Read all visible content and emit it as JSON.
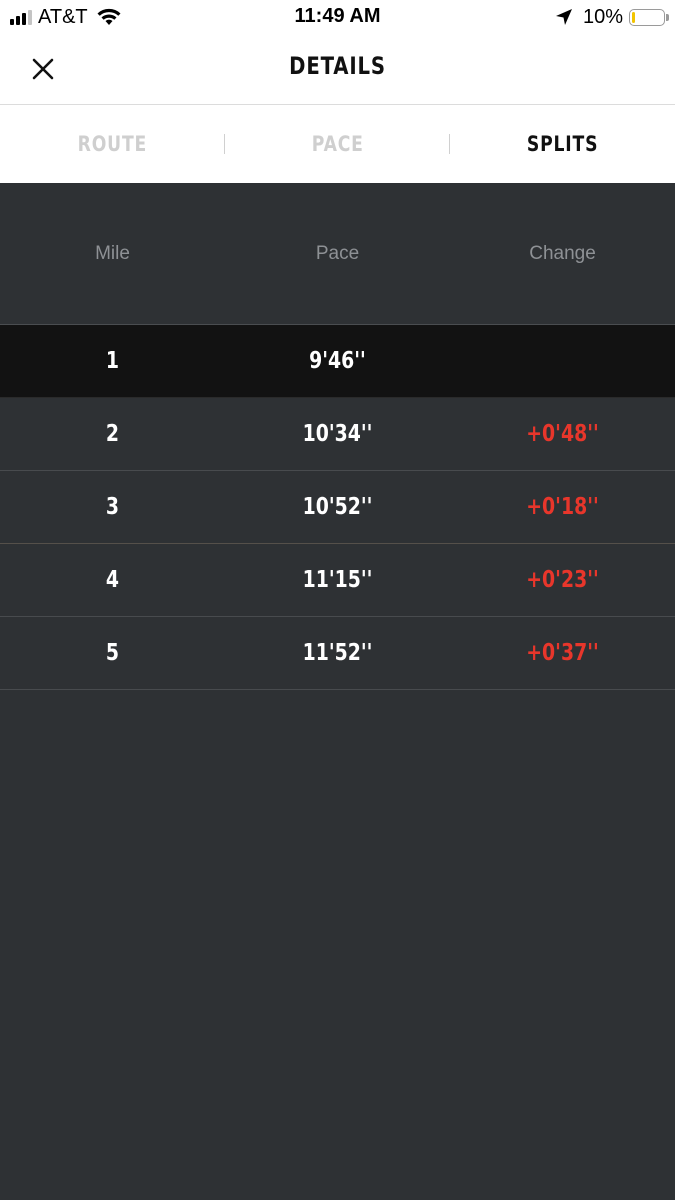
{
  "status_bar": {
    "carrier": "AT&T",
    "time": "11:49 AM",
    "battery_percent": "10%",
    "battery_level": 0.1,
    "battery_color": "#f2c400",
    "icons": [
      "signal-icon",
      "wifi-icon",
      "location-arrow-icon",
      "battery-icon"
    ]
  },
  "header": {
    "title": "DETAILS",
    "close_icon": "close-icon"
  },
  "tabs": [
    {
      "label": "ROUTE",
      "active": false
    },
    {
      "label": "PACE",
      "active": false
    },
    {
      "label": "SPLITS",
      "active": true
    }
  ],
  "splits": {
    "columns": [
      "Mile",
      "Pace",
      "Change"
    ],
    "rows": [
      {
        "mile": "1",
        "pace": "9'46''",
        "change": ""
      },
      {
        "mile": "2",
        "pace": "10'34''",
        "change": "+0'48''"
      },
      {
        "mile": "3",
        "pace": "10'52''",
        "change": "+0'18''"
      },
      {
        "mile": "4",
        "pace": "11'15''",
        "change": "+0'23''"
      },
      {
        "mile": "5",
        "pace": "11'52''",
        "change": "+0'37''"
      }
    ],
    "change_color": "#e8362b"
  }
}
